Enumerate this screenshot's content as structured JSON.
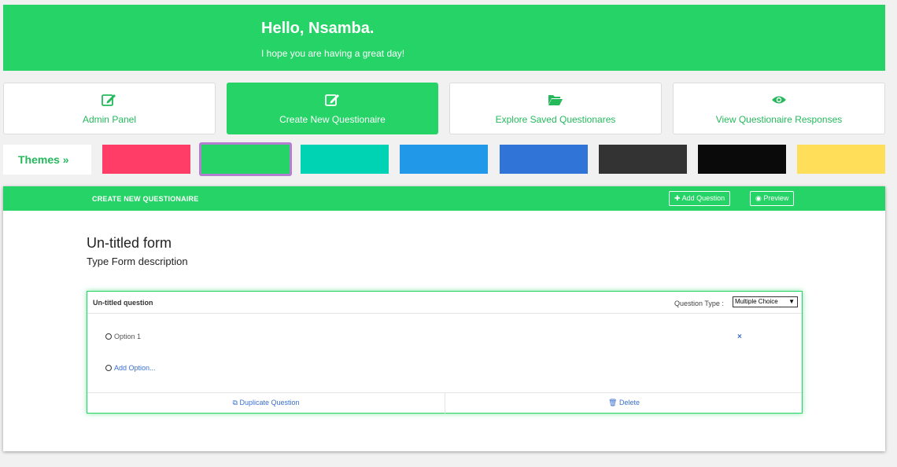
{
  "hero": {
    "greeting": "Hello, Nsamba.",
    "message": "I hope you are having a great day!",
    "color": "#25d366"
  },
  "nav": [
    {
      "label": "Admin Panel",
      "icon": "edit-icon",
      "active": false
    },
    {
      "label": "Create New Questionaire",
      "icon": "edit-icon",
      "active": true
    },
    {
      "label": "Explore Saved Questionares",
      "icon": "folder-open-icon",
      "active": false
    },
    {
      "label": "View Questionaire Responses",
      "icon": "eye-icon",
      "active": false
    }
  ],
  "themes": {
    "label": "Themes »",
    "swatches": [
      "#ff3d67",
      "#25d366",
      "#00d2b4",
      "#2199e8",
      "#3174d8",
      "#333333",
      "#0a0a0a",
      "#ffde59"
    ],
    "selected_index": 1
  },
  "panel": {
    "title": "CREATE NEW QUESTIONAIRE",
    "add_question": "Add Question",
    "preview": "Preview"
  },
  "form": {
    "title": "Un-titled form",
    "description": "Type Form description"
  },
  "question": {
    "title": "Un-titled question",
    "type_label": "Question Type :",
    "type_value": "Multiple Choice",
    "options": [
      "Option 1"
    ],
    "add_option": "Add Option...",
    "remove": "×",
    "duplicate": "Duplicate Question",
    "delete": "Delete"
  }
}
